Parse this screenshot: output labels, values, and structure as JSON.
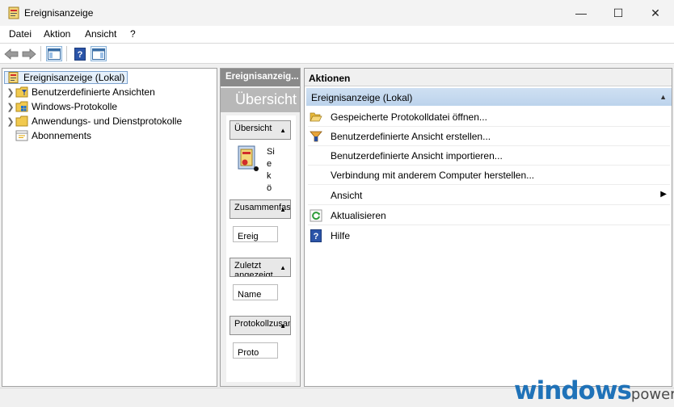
{
  "window": {
    "title": "Ereignisanzeige",
    "min_glyph": "—",
    "max_glyph": "☐",
    "close_glyph": "✕"
  },
  "menu": [
    "Datei",
    "Aktion",
    "Ansicht",
    "?"
  ],
  "toolbar": {
    "icons": [
      "back-arrow-icon",
      "forward-arrow-icon",
      "show-hide-tree-icon",
      "help-icon",
      "show-hide-action-pane-icon"
    ]
  },
  "tree": {
    "root": "Ereignisanzeige (Lokal)",
    "items": [
      "Benutzerdefinierte Ansichten",
      "Windows-Protokolle",
      "Anwendungs- und Dienstprotokolle",
      "Abonnements"
    ]
  },
  "middle": {
    "header": "Ereignisanzeig...",
    "banner": "Übersicht",
    "sections": [
      {
        "title": "Übersicht",
        "content": ""
      },
      {
        "title": "Zusammenfassung",
        "content": "Ereig"
      },
      {
        "title": "Zuletzt angezeigt",
        "content": "Name"
      },
      {
        "title": "Protokollzusammenfassung",
        "content": "Proto"
      }
    ],
    "overview_text": [
      "Si",
      "e",
      "k",
      "ö"
    ]
  },
  "actions": {
    "header": "Aktionen",
    "group": "Ereignisanzeige (Lokal)",
    "items": [
      {
        "label": "Gespeicherte Protokolldatei öffnen...",
        "icon": "open-folder-icon"
      },
      {
        "label": "Benutzerdefinierte Ansicht erstellen...",
        "icon": "filter-icon"
      },
      {
        "label": "Benutzerdefinierte Ansicht importieren...",
        "icon": ""
      },
      {
        "label": "Verbindung mit anderem Computer herstellen...",
        "icon": ""
      },
      {
        "label": "Ansicht",
        "icon": "",
        "submenu": true
      },
      {
        "label": "Aktualisieren",
        "icon": "refresh-icon"
      },
      {
        "label": "Hilfe",
        "icon": "help-icon"
      }
    ]
  },
  "watermark": {
    "main": "windows",
    "suffix": "power."
  },
  "colors": {
    "accent": "#1f72b8",
    "group_bg": "#c6daef",
    "header_gray": "#8a8a8a"
  }
}
